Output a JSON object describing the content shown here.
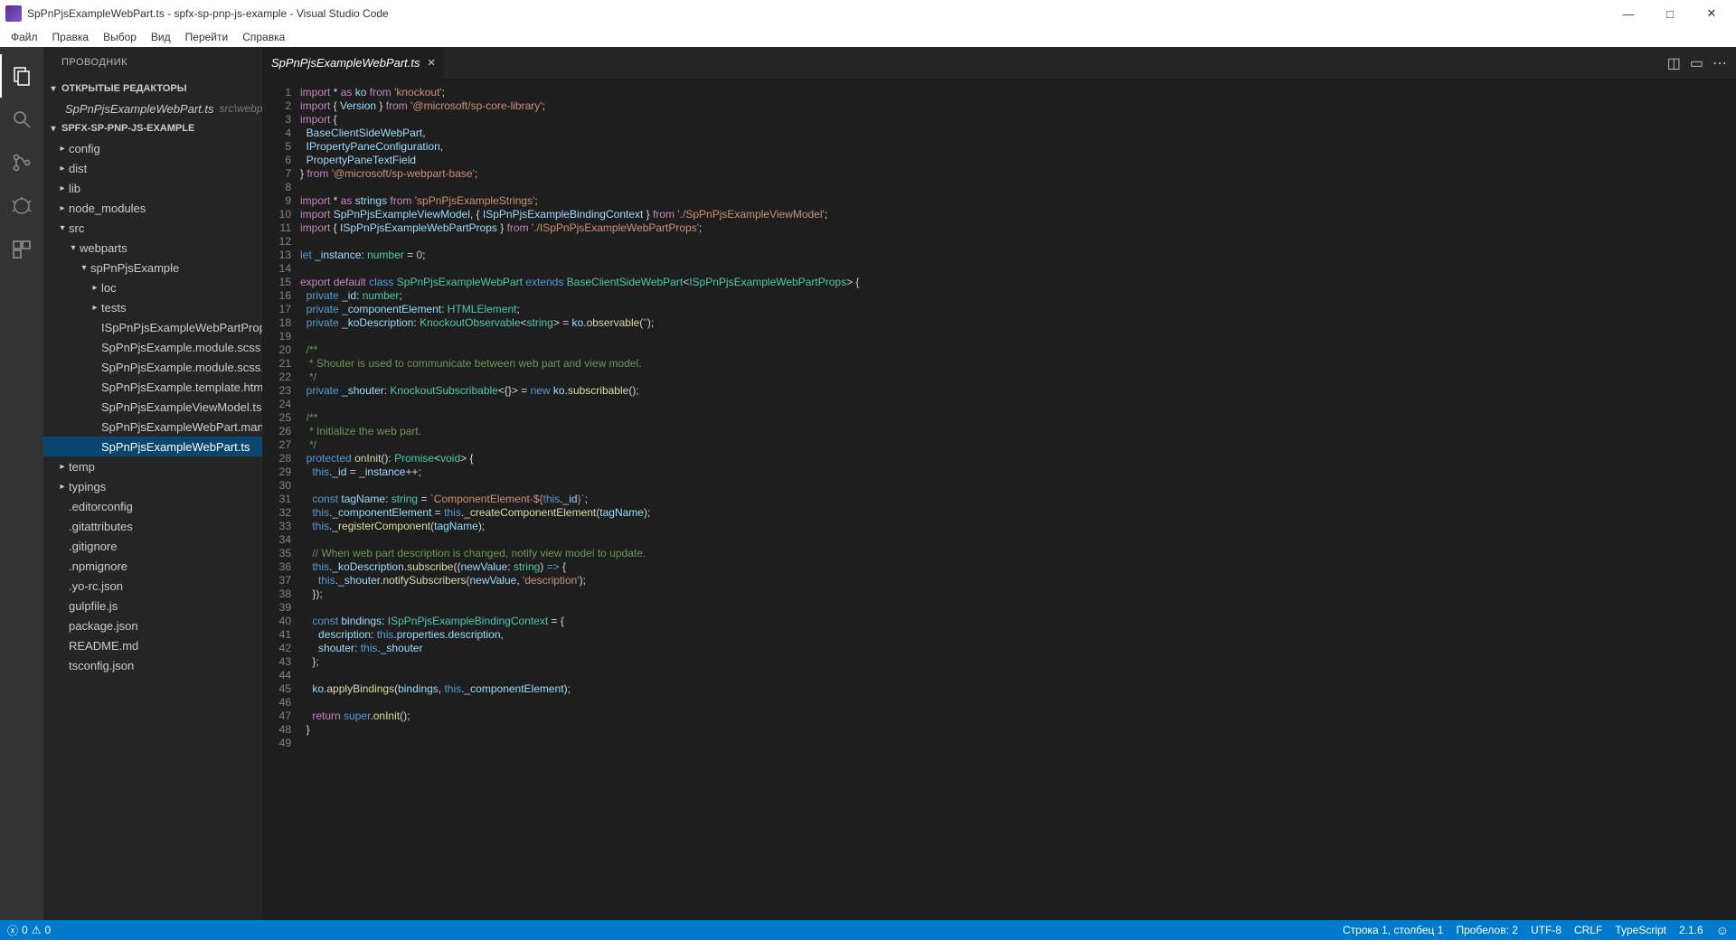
{
  "window": {
    "title": "SpPnPjsExampleWebPart.ts - spfx-sp-pnp-js-example - Visual Studio Code"
  },
  "menu": {
    "items": [
      "Файл",
      "Правка",
      "Выбор",
      "Вид",
      "Перейти",
      "Справка"
    ]
  },
  "activity": {
    "active": 0
  },
  "explorer": {
    "title": "ПРОВОДНИК",
    "sections": {
      "openEditors": {
        "label": "ОТКРЫТЫЕ РЕДАКТОРЫ"
      },
      "folder": {
        "label": "SPFX-SP-PNP-JS-EXAMPLE"
      }
    },
    "openEditors": [
      {
        "name": "SpPnPjsExampleWebPart.ts",
        "path": "src\\webparts\\spPnPjsEx..."
      }
    ],
    "tree": [
      {
        "depth": 0,
        "type": "folder",
        "open": false,
        "label": "config"
      },
      {
        "depth": 0,
        "type": "folder",
        "open": false,
        "label": "dist"
      },
      {
        "depth": 0,
        "type": "folder",
        "open": false,
        "label": "lib"
      },
      {
        "depth": 0,
        "type": "folder",
        "open": false,
        "label": "node_modules"
      },
      {
        "depth": 0,
        "type": "folder",
        "open": true,
        "label": "src"
      },
      {
        "depth": 1,
        "type": "folder",
        "open": true,
        "label": "webparts"
      },
      {
        "depth": 2,
        "type": "folder",
        "open": true,
        "label": "spPnPjsExample"
      },
      {
        "depth": 3,
        "type": "folder",
        "open": false,
        "label": "loc"
      },
      {
        "depth": 3,
        "type": "folder",
        "open": false,
        "label": "tests"
      },
      {
        "depth": 3,
        "type": "file",
        "label": "ISpPnPjsExampleWebPartProps.ts"
      },
      {
        "depth": 3,
        "type": "file",
        "label": "SpPnPjsExample.module.scss"
      },
      {
        "depth": 3,
        "type": "file",
        "label": "SpPnPjsExample.module.scss.ts"
      },
      {
        "depth": 3,
        "type": "file",
        "label": "SpPnPjsExample.template.html"
      },
      {
        "depth": 3,
        "type": "file",
        "label": "SpPnPjsExampleViewModel.ts"
      },
      {
        "depth": 3,
        "type": "file",
        "label": "SpPnPjsExampleWebPart.manifest.json"
      },
      {
        "depth": 3,
        "type": "file",
        "label": "SpPnPjsExampleWebPart.ts",
        "selected": true
      },
      {
        "depth": 0,
        "type": "folder",
        "open": false,
        "label": "temp"
      },
      {
        "depth": 0,
        "type": "folder",
        "open": false,
        "label": "typings"
      },
      {
        "depth": 0,
        "type": "file",
        "label": ".editorconfig"
      },
      {
        "depth": 0,
        "type": "file",
        "label": ".gitattributes"
      },
      {
        "depth": 0,
        "type": "file",
        "label": ".gitignore"
      },
      {
        "depth": 0,
        "type": "file",
        "label": ".npmignore"
      },
      {
        "depth": 0,
        "type": "file",
        "label": ".yo-rc.json"
      },
      {
        "depth": 0,
        "type": "file",
        "label": "gulpfile.js"
      },
      {
        "depth": 0,
        "type": "file",
        "label": "package.json"
      },
      {
        "depth": 0,
        "type": "file",
        "label": "README.md"
      },
      {
        "depth": 0,
        "type": "file",
        "label": "tsconfig.json"
      }
    ]
  },
  "editor": {
    "tab": "SpPnPjsExampleWebPart.ts",
    "lineCount": 49,
    "code": [
      [
        [
          "kw2",
          "import"
        ],
        [
          "pun",
          " * "
        ],
        [
          "kw2",
          "as"
        ],
        [
          "pun",
          " "
        ],
        [
          "var",
          "ko"
        ],
        [
          "pun",
          " "
        ],
        [
          "kw2",
          "from"
        ],
        [
          "pun",
          " "
        ],
        [
          "str",
          "'knockout'"
        ],
        [
          "pun",
          ";"
        ]
      ],
      [
        [
          "kw2",
          "import"
        ],
        [
          "pun",
          " { "
        ],
        [
          "var",
          "Version"
        ],
        [
          "pun",
          " } "
        ],
        [
          "kw2",
          "from"
        ],
        [
          "pun",
          " "
        ],
        [
          "str",
          "'@microsoft/sp-core-library'"
        ],
        [
          "pun",
          ";"
        ]
      ],
      [
        [
          "kw2",
          "import"
        ],
        [
          "pun",
          " {"
        ]
      ],
      [
        [
          "pun",
          "  "
        ],
        [
          "var",
          "BaseClientSideWebPart"
        ],
        [
          "pun",
          ","
        ]
      ],
      [
        [
          "pun",
          "  "
        ],
        [
          "var",
          "IPropertyPaneConfiguration"
        ],
        [
          "pun",
          ","
        ]
      ],
      [
        [
          "pun",
          "  "
        ],
        [
          "var",
          "PropertyPaneTextField"
        ]
      ],
      [
        [
          "pun",
          "} "
        ],
        [
          "kw2",
          "from"
        ],
        [
          "pun",
          " "
        ],
        [
          "str",
          "'@microsoft/sp-webpart-base'"
        ],
        [
          "pun",
          ";"
        ]
      ],
      [
        [
          "pun",
          ""
        ]
      ],
      [
        [
          "kw2",
          "import"
        ],
        [
          "pun",
          " * "
        ],
        [
          "kw2",
          "as"
        ],
        [
          "pun",
          " "
        ],
        [
          "var",
          "strings"
        ],
        [
          "pun",
          " "
        ],
        [
          "kw2",
          "from"
        ],
        [
          "pun",
          " "
        ],
        [
          "str",
          "'spPnPjsExampleStrings'"
        ],
        [
          "pun",
          ";"
        ]
      ],
      [
        [
          "kw2",
          "import"
        ],
        [
          "pun",
          " "
        ],
        [
          "var",
          "SpPnPjsExampleViewModel"
        ],
        [
          "pun",
          ", { "
        ],
        [
          "var",
          "ISpPnPjsExampleBindingContext"
        ],
        [
          "pun",
          " } "
        ],
        [
          "kw2",
          "from"
        ],
        [
          "pun",
          " "
        ],
        [
          "str",
          "'./SpPnPjsExampleViewModel'"
        ],
        [
          "pun",
          ";"
        ]
      ],
      [
        [
          "kw2",
          "import"
        ],
        [
          "pun",
          " { "
        ],
        [
          "var",
          "ISpPnPjsExampleWebPartProps"
        ],
        [
          "pun",
          " } "
        ],
        [
          "kw2",
          "from"
        ],
        [
          "pun",
          " "
        ],
        [
          "str",
          "'./ISpPnPjsExampleWebPartProps'"
        ],
        [
          "pun",
          ";"
        ]
      ],
      [
        [
          "pun",
          ""
        ]
      ],
      [
        [
          "kw",
          "let"
        ],
        [
          "pun",
          " "
        ],
        [
          "var",
          "_instance"
        ],
        [
          "pun",
          ": "
        ],
        [
          "cls",
          "number"
        ],
        [
          "pun",
          " = "
        ],
        [
          "num",
          "0"
        ],
        [
          "pun",
          ";"
        ]
      ],
      [
        [
          "pun",
          ""
        ]
      ],
      [
        [
          "kw2",
          "export"
        ],
        [
          "pun",
          " "
        ],
        [
          "kw2",
          "default"
        ],
        [
          "pun",
          " "
        ],
        [
          "kw",
          "class"
        ],
        [
          "pun",
          " "
        ],
        [
          "cls",
          "SpPnPjsExampleWebPart"
        ],
        [
          "pun",
          " "
        ],
        [
          "kw",
          "extends"
        ],
        [
          "pun",
          " "
        ],
        [
          "cls",
          "BaseClientSideWebPart"
        ],
        [
          "pun",
          "<"
        ],
        [
          "cls",
          "ISpPnPjsExampleWebPartProps"
        ],
        [
          "pun",
          "> {"
        ]
      ],
      [
        [
          "pun",
          "  "
        ],
        [
          "kw",
          "private"
        ],
        [
          "pun",
          " "
        ],
        [
          "var",
          "_id"
        ],
        [
          "pun",
          ": "
        ],
        [
          "cls",
          "number"
        ],
        [
          "pun",
          ";"
        ]
      ],
      [
        [
          "pun",
          "  "
        ],
        [
          "kw",
          "private"
        ],
        [
          "pun",
          " "
        ],
        [
          "var",
          "_componentElement"
        ],
        [
          "pun",
          ": "
        ],
        [
          "cls",
          "HTMLElement"
        ],
        [
          "pun",
          ";"
        ]
      ],
      [
        [
          "pun",
          "  "
        ],
        [
          "kw",
          "private"
        ],
        [
          "pun",
          " "
        ],
        [
          "var",
          "_koDescription"
        ],
        [
          "pun",
          ": "
        ],
        [
          "cls",
          "KnockoutObservable"
        ],
        [
          "pun",
          "<"
        ],
        [
          "cls",
          "string"
        ],
        [
          "pun",
          "> = "
        ],
        [
          "var",
          "ko"
        ],
        [
          "pun",
          "."
        ],
        [
          "fn",
          "observable"
        ],
        [
          "pun",
          "("
        ],
        [
          "str",
          "''"
        ],
        [
          "pun",
          ");"
        ]
      ],
      [
        [
          "pun",
          ""
        ]
      ],
      [
        [
          "pun",
          "  "
        ],
        [
          "cmt",
          "/**"
        ]
      ],
      [
        [
          "pun",
          "   "
        ],
        [
          "cmt",
          "* Shouter is used to communicate between web part and view model."
        ]
      ],
      [
        [
          "pun",
          "   "
        ],
        [
          "cmt",
          "*/"
        ]
      ],
      [
        [
          "pun",
          "  "
        ],
        [
          "kw",
          "private"
        ],
        [
          "pun",
          " "
        ],
        [
          "var",
          "_shouter"
        ],
        [
          "pun",
          ": "
        ],
        [
          "cls",
          "KnockoutSubscribable"
        ],
        [
          "pun",
          "<{}> = "
        ],
        [
          "kw",
          "new"
        ],
        [
          "pun",
          " "
        ],
        [
          "var",
          "ko"
        ],
        [
          "pun",
          "."
        ],
        [
          "fn",
          "subscribable"
        ],
        [
          "pun",
          "();"
        ]
      ],
      [
        [
          "pun",
          ""
        ]
      ],
      [
        [
          "pun",
          "  "
        ],
        [
          "cmt",
          "/**"
        ]
      ],
      [
        [
          "pun",
          "   "
        ],
        [
          "cmt",
          "* Initialize the web part."
        ]
      ],
      [
        [
          "pun",
          "   "
        ],
        [
          "cmt",
          "*/"
        ]
      ],
      [
        [
          "pun",
          "  "
        ],
        [
          "kw",
          "protected"
        ],
        [
          "pun",
          " "
        ],
        [
          "fn",
          "onInit"
        ],
        [
          "pun",
          "(): "
        ],
        [
          "cls",
          "Promise"
        ],
        [
          "pun",
          "<"
        ],
        [
          "cls",
          "void"
        ],
        [
          "pun",
          "> {"
        ]
      ],
      [
        [
          "pun",
          "    "
        ],
        [
          "kw",
          "this"
        ],
        [
          "pun",
          "."
        ],
        [
          "var",
          "_id"
        ],
        [
          "pun",
          " = "
        ],
        [
          "var",
          "_instance"
        ],
        [
          "pun",
          "++;"
        ]
      ],
      [
        [
          "pun",
          ""
        ]
      ],
      [
        [
          "pun",
          "    "
        ],
        [
          "kw",
          "const"
        ],
        [
          "pun",
          " "
        ],
        [
          "var",
          "tagName"
        ],
        [
          "pun",
          ": "
        ],
        [
          "cls",
          "string"
        ],
        [
          "pun",
          " = "
        ],
        [
          "str",
          "`ComponentElement-${"
        ],
        [
          "kw",
          "this"
        ],
        [
          "pun",
          "."
        ],
        [
          "var",
          "_id"
        ],
        [
          "str",
          "}`"
        ],
        [
          "pun",
          ";"
        ]
      ],
      [
        [
          "pun",
          "    "
        ],
        [
          "kw",
          "this"
        ],
        [
          "pun",
          "."
        ],
        [
          "var",
          "_componentElement"
        ],
        [
          "pun",
          " = "
        ],
        [
          "kw",
          "this"
        ],
        [
          "pun",
          "."
        ],
        [
          "fn",
          "_createComponentElement"
        ],
        [
          "pun",
          "("
        ],
        [
          "var",
          "tagName"
        ],
        [
          "pun",
          ");"
        ]
      ],
      [
        [
          "pun",
          "    "
        ],
        [
          "kw",
          "this"
        ],
        [
          "pun",
          "."
        ],
        [
          "fn",
          "_registerComponent"
        ],
        [
          "pun",
          "("
        ],
        [
          "var",
          "tagName"
        ],
        [
          "pun",
          ");"
        ]
      ],
      [
        [
          "pun",
          ""
        ]
      ],
      [
        [
          "pun",
          "    "
        ],
        [
          "cmt",
          "// When web part description is changed, notify view model to update."
        ]
      ],
      [
        [
          "pun",
          "    "
        ],
        [
          "kw",
          "this"
        ],
        [
          "pun",
          "."
        ],
        [
          "var",
          "_koDescription"
        ],
        [
          "pun",
          "."
        ],
        [
          "fn",
          "subscribe"
        ],
        [
          "pun",
          "(("
        ],
        [
          "var",
          "newValue"
        ],
        [
          "pun",
          ": "
        ],
        [
          "cls",
          "string"
        ],
        [
          "pun",
          ") "
        ],
        [
          "kw",
          "=>"
        ],
        [
          "pun",
          " {"
        ]
      ],
      [
        [
          "pun",
          "      "
        ],
        [
          "kw",
          "this"
        ],
        [
          "pun",
          "."
        ],
        [
          "var",
          "_shouter"
        ],
        [
          "pun",
          "."
        ],
        [
          "fn",
          "notifySubscribers"
        ],
        [
          "pun",
          "("
        ],
        [
          "var",
          "newValue"
        ],
        [
          "pun",
          ", "
        ],
        [
          "str",
          "'description'"
        ],
        [
          "pun",
          ");"
        ]
      ],
      [
        [
          "pun",
          "    });"
        ]
      ],
      [
        [
          "pun",
          ""
        ]
      ],
      [
        [
          "pun",
          "    "
        ],
        [
          "kw",
          "const"
        ],
        [
          "pun",
          " "
        ],
        [
          "var",
          "bindings"
        ],
        [
          "pun",
          ": "
        ],
        [
          "cls",
          "ISpPnPjsExampleBindingContext"
        ],
        [
          "pun",
          " = {"
        ]
      ],
      [
        [
          "pun",
          "      "
        ],
        [
          "var",
          "description"
        ],
        [
          "pun",
          ": "
        ],
        [
          "kw",
          "this"
        ],
        [
          "pun",
          "."
        ],
        [
          "var",
          "properties"
        ],
        [
          "pun",
          "."
        ],
        [
          "var",
          "description"
        ],
        [
          "pun",
          ","
        ]
      ],
      [
        [
          "pun",
          "      "
        ],
        [
          "var",
          "shouter"
        ],
        [
          "pun",
          ": "
        ],
        [
          "kw",
          "this"
        ],
        [
          "pun",
          "."
        ],
        [
          "var",
          "_shouter"
        ]
      ],
      [
        [
          "pun",
          "    };"
        ]
      ],
      [
        [
          "pun",
          ""
        ]
      ],
      [
        [
          "pun",
          "    "
        ],
        [
          "var",
          "ko"
        ],
        [
          "pun",
          "."
        ],
        [
          "fn",
          "applyBindings"
        ],
        [
          "pun",
          "("
        ],
        [
          "var",
          "bindings"
        ],
        [
          "pun",
          ", "
        ],
        [
          "kw",
          "this"
        ],
        [
          "pun",
          "."
        ],
        [
          "var",
          "_componentElement"
        ],
        [
          "pun",
          ");"
        ]
      ],
      [
        [
          "pun",
          ""
        ]
      ],
      [
        [
          "pun",
          "    "
        ],
        [
          "kw2",
          "return"
        ],
        [
          "pun",
          " "
        ],
        [
          "kw",
          "super"
        ],
        [
          "pun",
          "."
        ],
        [
          "fn",
          "onInit"
        ],
        [
          "pun",
          "();"
        ]
      ],
      [
        [
          "pun",
          "  }"
        ]
      ],
      [
        [
          "pun",
          ""
        ]
      ]
    ]
  },
  "status": {
    "errors": "0",
    "warnings": "0",
    "linecol": "Строка 1, столбец 1",
    "spaces": "Пробелов: 2",
    "encoding": "UTF-8",
    "eol": "CRLF",
    "language": "TypeScript",
    "version": "2.1.6"
  }
}
